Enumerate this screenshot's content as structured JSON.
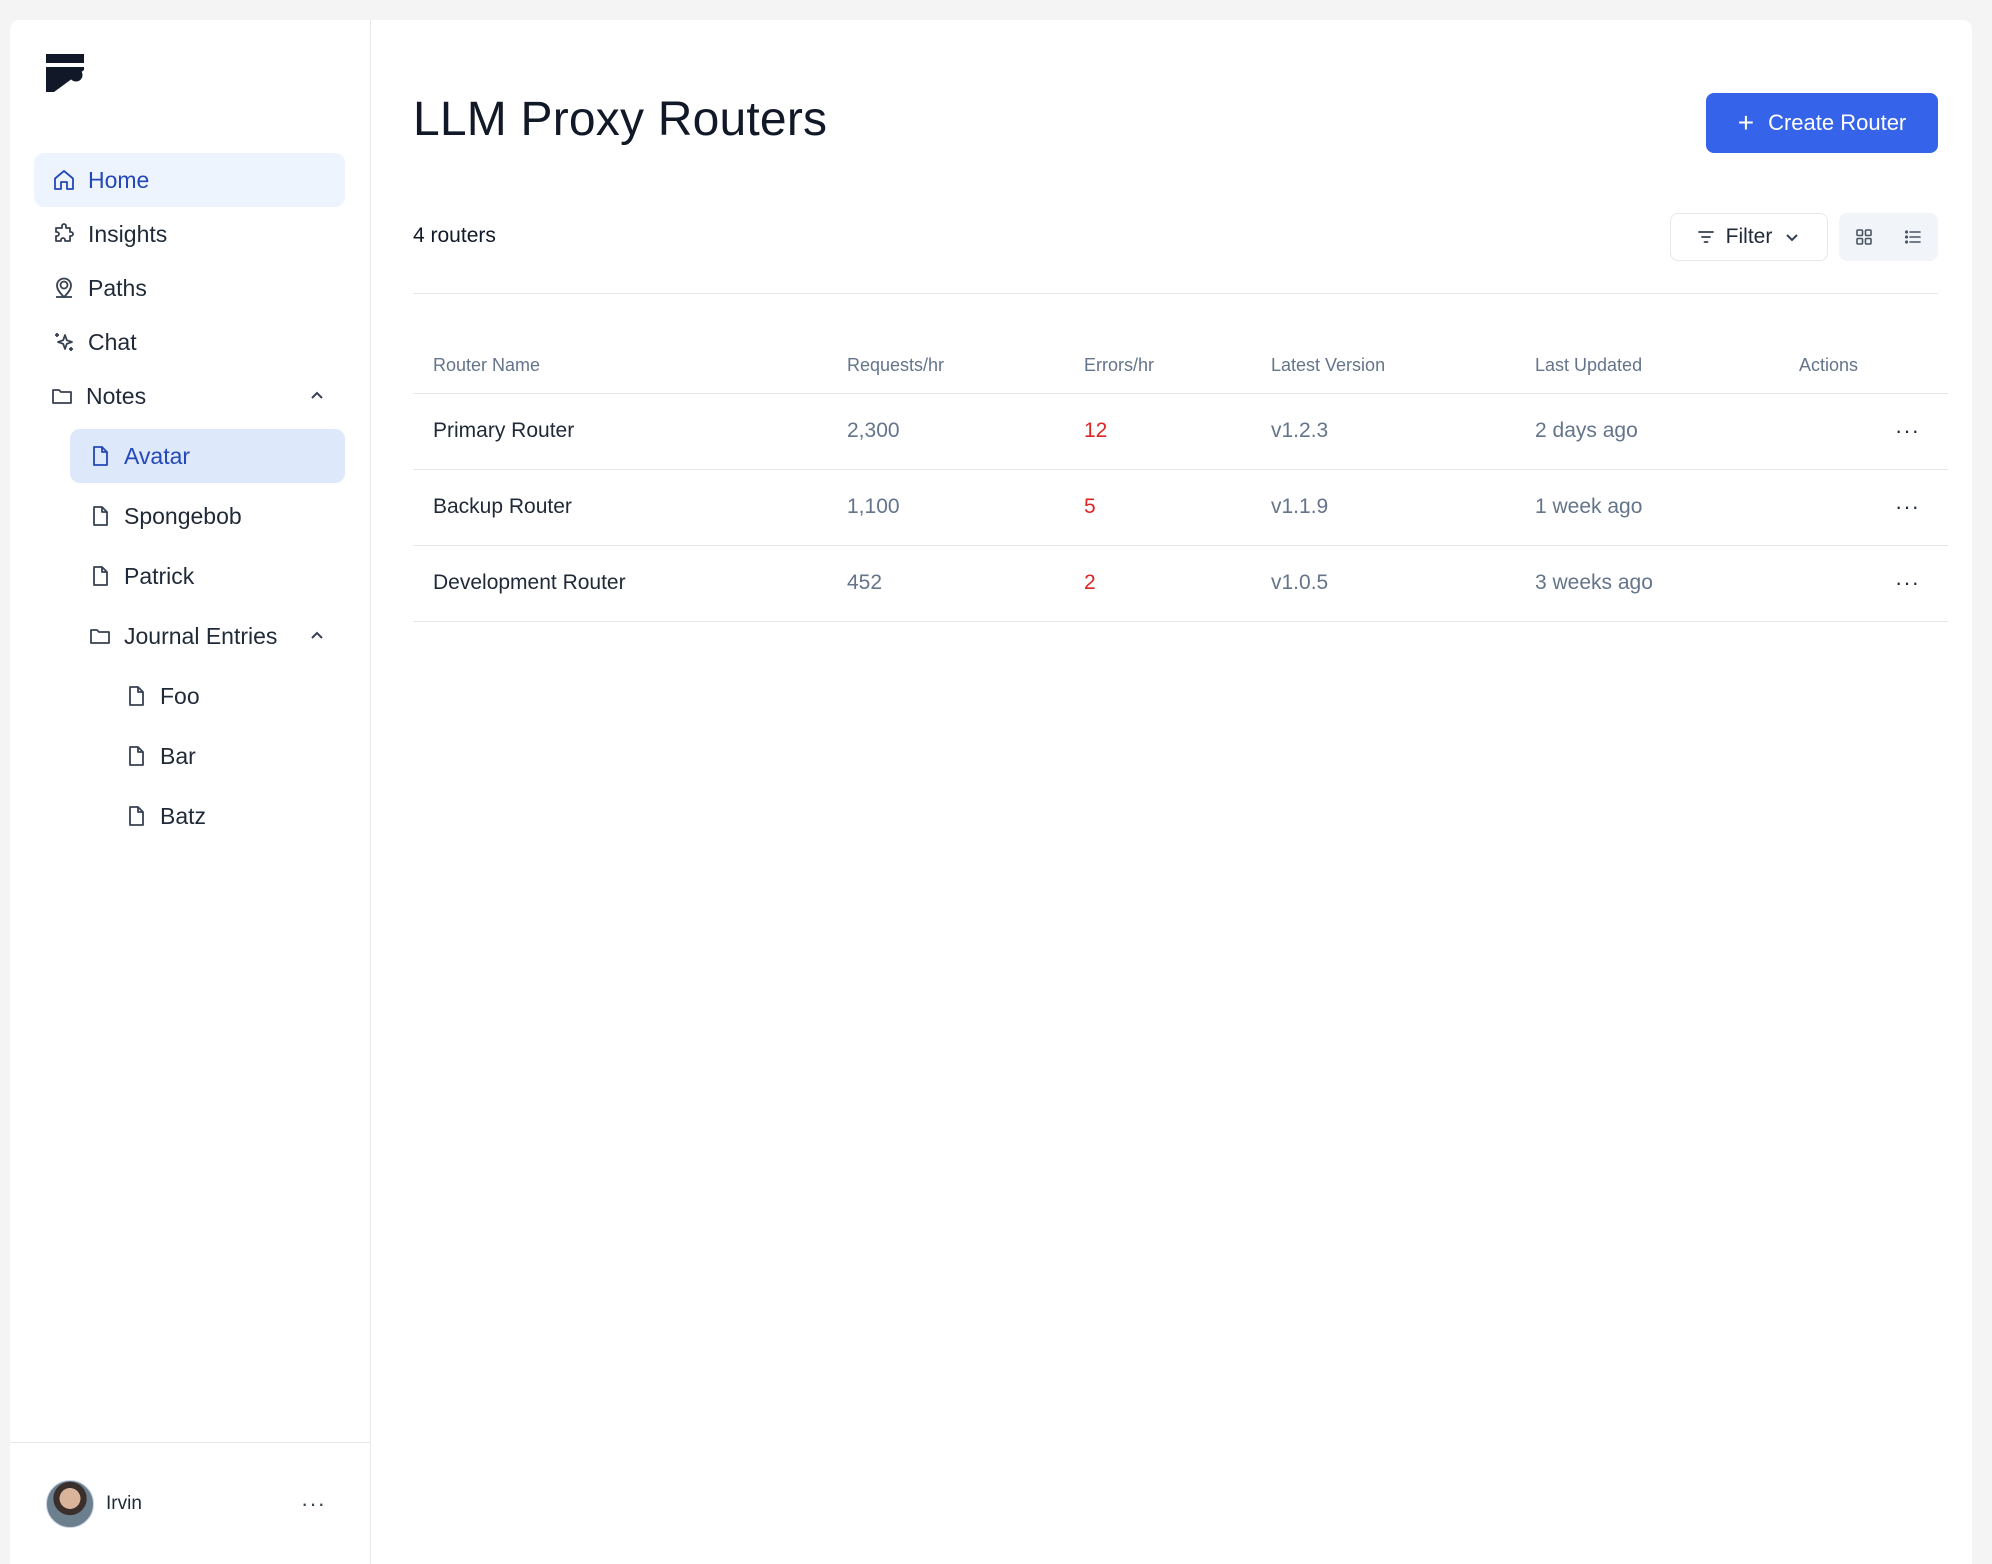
{
  "sidebar": {
    "nav": [
      {
        "label": "Home",
        "icon": "home-icon",
        "active": true
      },
      {
        "label": "Insights",
        "icon": "puzzle-icon"
      },
      {
        "label": "Paths",
        "icon": "map-pin-user-icon"
      },
      {
        "label": "Chat",
        "icon": "sparkles-icon"
      }
    ],
    "notes": {
      "label": "Notes",
      "items": [
        "Avatar",
        "Spongebob",
        "Patrick"
      ],
      "journal": {
        "label": "Journal Entries",
        "items": [
          "Foo",
          "Bar",
          "Batz"
        ]
      }
    },
    "user": {
      "name": "Irvin",
      "more": "···"
    }
  },
  "header": {
    "title": "LLM Proxy Routers",
    "create_label": "Create Router",
    "count_label": "4 routers",
    "filter_label": "Filter"
  },
  "table": {
    "columns": [
      "Router Name",
      "Requests/hr",
      "Errors/hr",
      "Latest Version",
      "Last Updated",
      "Actions"
    ],
    "rows": [
      {
        "name": "Primary Router",
        "requests": "2,300",
        "errors": "12",
        "version": "v1.2.3",
        "updated": "2 days ago",
        "more": "···"
      },
      {
        "name": "Backup Router",
        "requests": "1,100",
        "errors": "5",
        "version": "v1.1.9",
        "updated": "1 week ago",
        "more": "···"
      },
      {
        "name": "Development Router",
        "requests": "452",
        "errors": "2",
        "version": "v1.0.5",
        "updated": "3 weeks ago",
        "more": "···"
      }
    ]
  },
  "colors": {
    "accent": "#3563e9",
    "active_bg": "#eef4fd",
    "selected_bg": "#dde8fb",
    "error": "#dc2626"
  }
}
